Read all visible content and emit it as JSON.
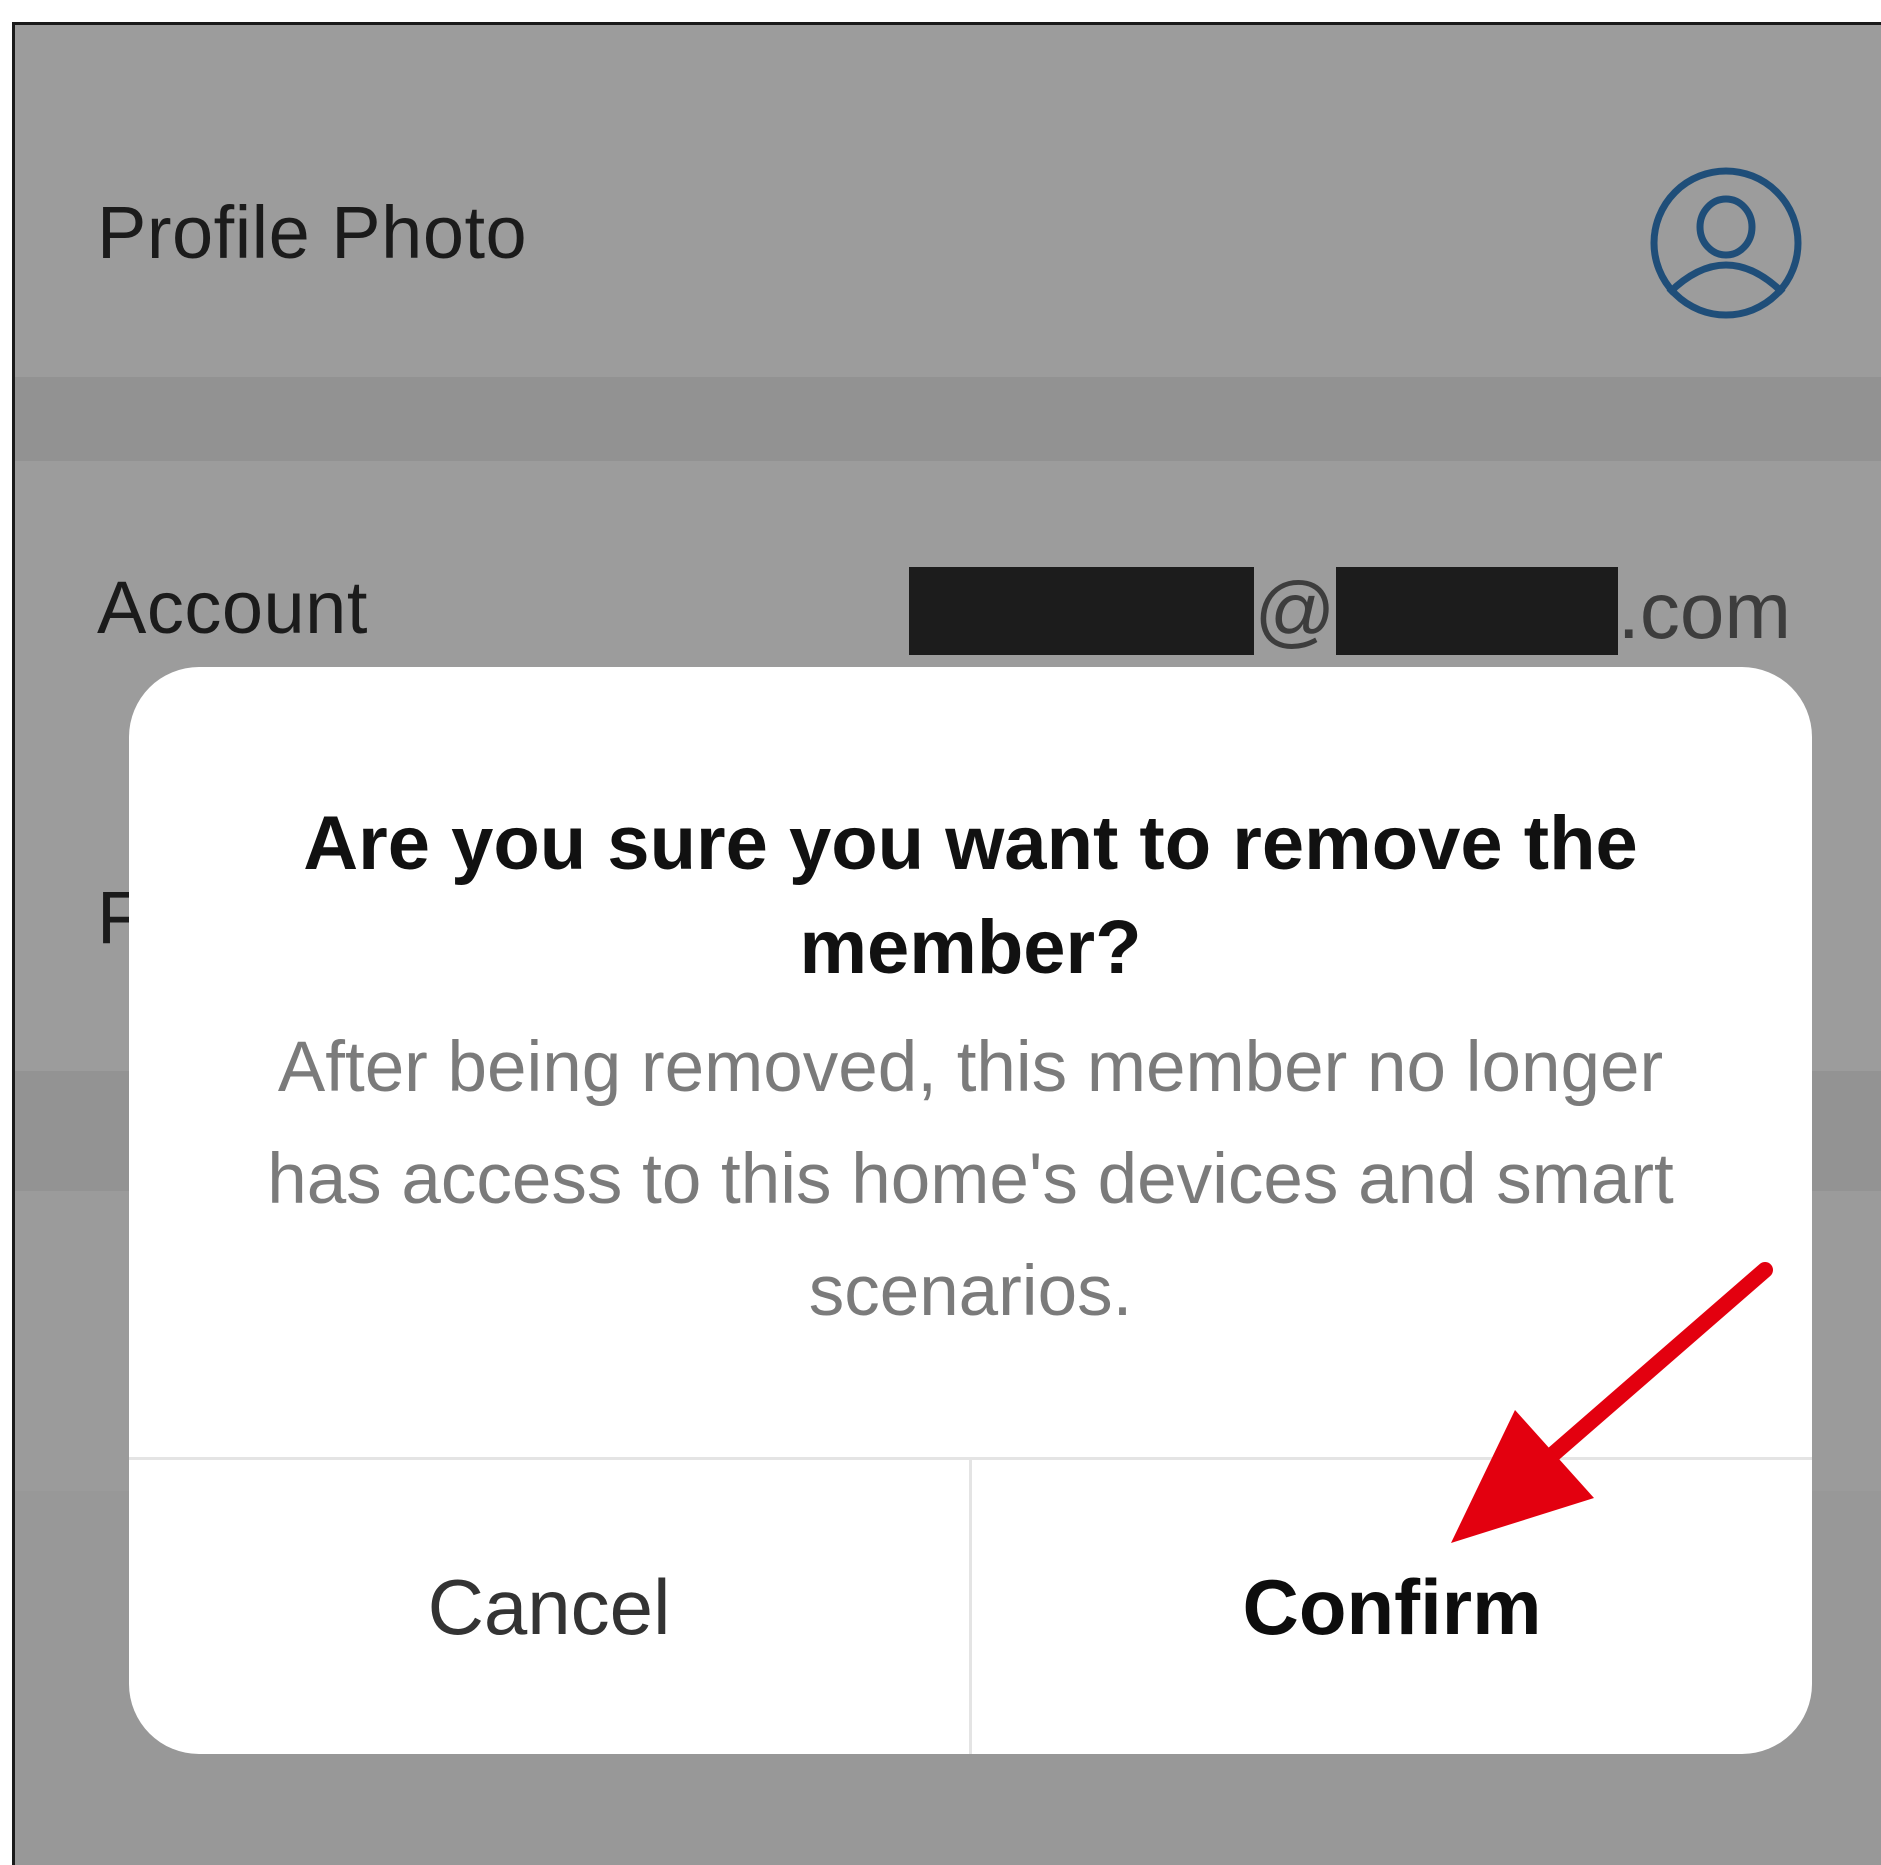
{
  "page": {
    "rows": {
      "profile_photo_label": "Profile Photo",
      "account_label": "Account",
      "account_value_at": "@",
      "account_value_suffix": ".com",
      "third_row_label_partial": "F"
    },
    "icons": {
      "avatar": "user-avatar-icon",
      "chevron": "chevron-right-icon"
    }
  },
  "dialog": {
    "title": "Are you sure you want to remove the member?",
    "body": "After being removed, this member no longer has access to this home's devices and smart scenarios.",
    "cancel_label": "Cancel",
    "confirm_label": "Confirm"
  },
  "annotation": {
    "arrow_color": "#e3000f",
    "points_to": "confirm-button"
  },
  "colors": {
    "overlay": "#9a9a9a",
    "avatar_stroke": "#1f4e79",
    "dialog_bg": "#ffffff",
    "body_text": "#7b7b7b"
  }
}
